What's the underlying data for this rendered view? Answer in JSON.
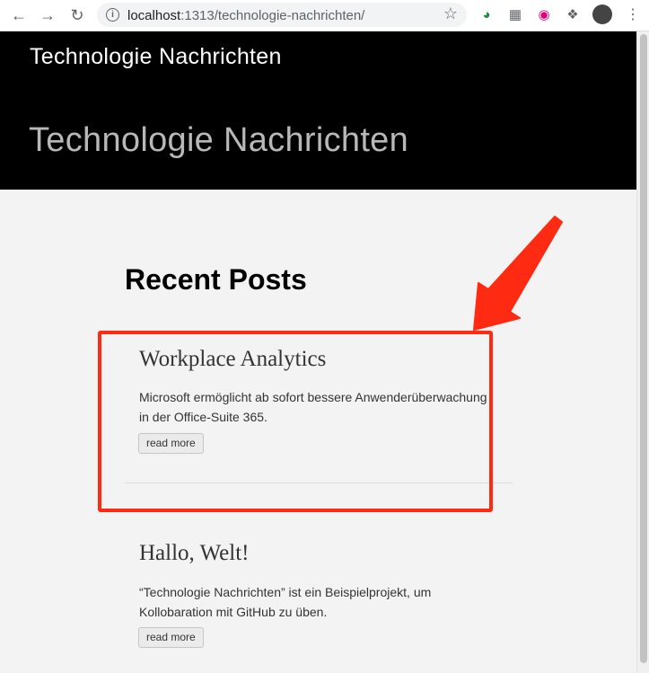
{
  "browser": {
    "url_host": "localhost",
    "url_path": ":1313/technologie-nachrichten/"
  },
  "site": {
    "name": "Technologie Nachrichten",
    "hero_title": "Technologie Nachrichten"
  },
  "main": {
    "section_title": "Recent Posts",
    "posts": [
      {
        "title": "Workplace Analytics",
        "excerpt": "Microsoft ermöglicht ab sofort bessere Anwenderüberwachung in der Office-Suite 365.",
        "read_more": "read more"
      },
      {
        "title": "Hallo, Welt!",
        "excerpt": "“Technologie Nachrichten” ist ein Beispielprojekt, um Kollobaration mit GitHub zu üben.",
        "read_more": "read more"
      }
    ]
  },
  "colors": {
    "annotation": "#ff2a12",
    "header_bg": "#000000"
  }
}
